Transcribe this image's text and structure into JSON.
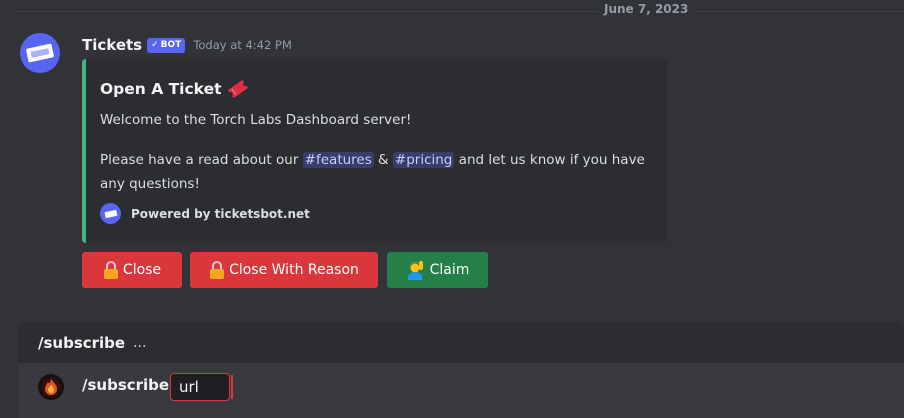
{
  "divider": {
    "date": "June 7, 2023"
  },
  "message": {
    "username": "Tickets",
    "bot_tag": "BOT",
    "timestamp": "Today at 4:42 PM",
    "avatar_icon": "ticket-icon"
  },
  "embed": {
    "accent_color": "#43b581",
    "title": "Open A Ticket",
    "title_emoji": "ticket-emoji-icon",
    "welcome": "Welcome to the Torch Labs Dashboard server!",
    "line_prefix": "Please have a read about our ",
    "channel_features": "#features",
    "ampersand": " & ",
    "channel_pricing": "#pricing",
    "line_suffix": " and let us know if you have",
    "line_2": "any questions!",
    "footer": "Powered by ticketsbot.net"
  },
  "buttons": [
    {
      "label": "Close",
      "icon": "lock-icon",
      "style": "danger"
    },
    {
      "label": "Close With Reason",
      "icon": "lock-icon",
      "style": "danger"
    },
    {
      "label": "Claim",
      "icon": "person-raising-hand-icon",
      "style": "success"
    }
  ],
  "command": {
    "name": "/subscribe",
    "ellipsis": "...",
    "input_command": "/subscribe",
    "option_value": "url"
  },
  "colors": {
    "background": "#313338",
    "blurple": "#5865f2",
    "danger": "#da373c",
    "success": "#248046"
  }
}
